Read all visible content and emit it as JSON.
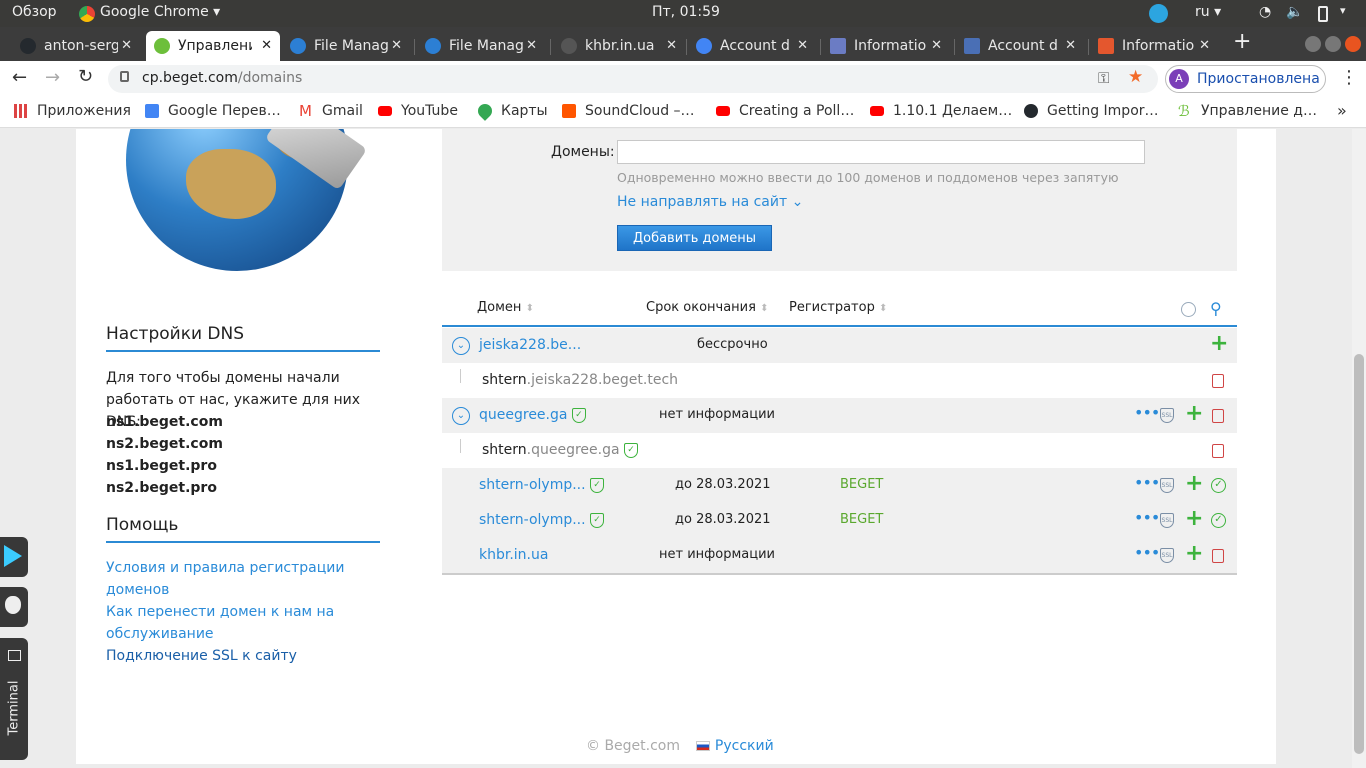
{
  "topbar": {
    "overview": "Обзор",
    "app": "Google Chrome",
    "clock": "Пт, 01:59",
    "lang": "ru"
  },
  "tabs": [
    {
      "label": "anton-serge",
      "color": "#24292e"
    },
    {
      "label": "Управлени",
      "color": "#6dbf3b"
    },
    {
      "label": "File Manag",
      "color": "#2c7fd4"
    },
    {
      "label": "File Manag",
      "color": "#2c7fd4"
    },
    {
      "label": "khbr.in.ua",
      "color": "#555555"
    },
    {
      "label": "Account d",
      "color": "#4285f4"
    },
    {
      "label": "Informatio",
      "color": "#6b7cc4"
    },
    {
      "label": "Account d",
      "color": "#4a6fb5"
    },
    {
      "label": "Informatio",
      "color": "#e4572e"
    }
  ],
  "address": {
    "url_host": "cp.beget.com",
    "url_path": "/domains",
    "profile_initial": "A",
    "profile_status": "Приостановлена"
  },
  "bookmarks": [
    {
      "label": "Приложения",
      "color": "#d44"
    },
    {
      "label": "Google Перев…",
      "color": "#4285f4"
    },
    {
      "label": "Gmail",
      "color": "#ea4335"
    },
    {
      "label": "YouTube",
      "color": "#ff0000"
    },
    {
      "label": "Карты",
      "color": "#34a853"
    },
    {
      "label": "SoundCloud –…",
      "color": "#ff5500"
    },
    {
      "label": "Creating a Poll…",
      "color": "#ff0000"
    },
    {
      "label": "1.10.1 Делаем…",
      "color": "#ff0000"
    },
    {
      "label": "Getting Impor…",
      "color": "#24292e"
    },
    {
      "label": "Управление д…",
      "color": "#6dbf3b"
    }
  ],
  "bookmarks_more": "»",
  "form": {
    "domains_label": "Домены:",
    "hint": "Одновременно можно ввести до 100 доменов и поддоменов через запятую",
    "redirect_label": "Не направлять на сайт",
    "submit": "Добавить домены"
  },
  "table": {
    "headers": {
      "domain": "Домен",
      "expires": "Срок окончания",
      "registrar": "Регистратор"
    },
    "rows": {
      "r1": {
        "domain": "jeiska228.be...",
        "expires": "бессрочно"
      },
      "r2": {
        "sub": "shtern",
        "parent": ".jeiska228.beget.tech"
      },
      "r3": {
        "domain": "queegree.ga",
        "expires": "нет информации"
      },
      "r4": {
        "sub": "shtern",
        "parent": ".queegree.ga"
      },
      "r5": {
        "domain": "shtern-olymp...",
        "expires": "до 28.03.2021",
        "registrar": "BEGET"
      },
      "r6": {
        "domain": "shtern-olymp...",
        "expires": "до 28.03.2021",
        "registrar": "BEGET"
      },
      "r7": {
        "domain": "khbr.in.ua",
        "expires": "нет информации"
      }
    }
  },
  "sidebar": {
    "dns_title": "Настройки DNS",
    "dns_text": "Для того чтобы домены начали работать от нас, укажите для них DNS:",
    "ns": [
      "ns1.beget.com",
      "ns2.beget.com",
      "ns1.beget.pro",
      "ns2.beget.pro"
    ],
    "help_title": "Помощь",
    "help_links": [
      "Условия и правила регистрации доменов",
      "Как перенести домен к нам на обслуживание",
      "Подключение SSL к сайту"
    ]
  },
  "footer": {
    "copyright": "© Beget.com",
    "language": "Русский"
  },
  "dock": {
    "terminal": "Terminal"
  },
  "icons": {
    "ssl": "SSL"
  }
}
